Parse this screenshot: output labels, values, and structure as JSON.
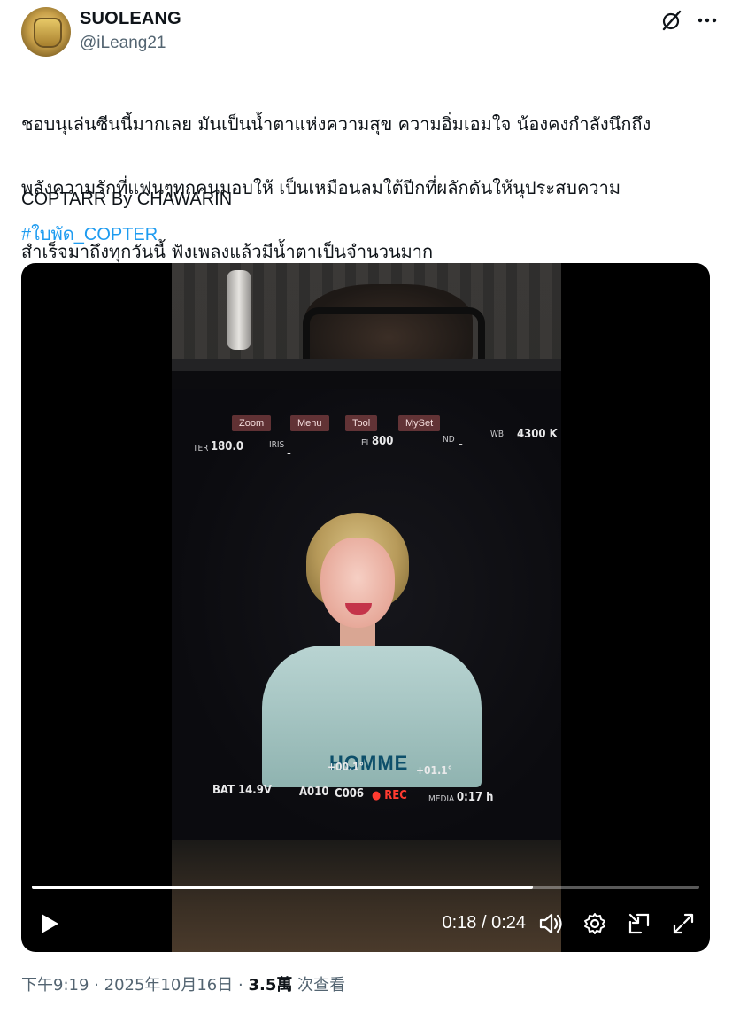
{
  "user": {
    "display_name": "SUOLEANG",
    "handle": "@iLeang21"
  },
  "tweet": {
    "text_line1": "ชอบนุเล่นซีนนี้มากเลย มันเป็นน้ำตาแห่งความสุข ความอิ่มเอมใจ น้องคงกำลังนึกถึง",
    "text_line2": "พลังความรักที่แฟนๆทุกคนมอบให้ เป็นเหมือนลมใต้ปีกที่ผลักดันให้นุประสบความ",
    "text_line3": "สำเร็จมาถึงทุกวันนี้ ฟังเพลงแล้วมีน้ำตาเป็นจำนวนมาก",
    "emojis": [
      "face-holding-back-tears-icon",
      "face-holding-back-tears-icon",
      "face-holding-back-tears-icon"
    ],
    "credit": "COPTARR By CHAWARIN",
    "hashtag": "#ใบพัด_COPTER"
  },
  "video": {
    "hud": {
      "menu_items": [
        "Zoom",
        "Menu",
        "Tool",
        "MySet"
      ],
      "shutter_label": "TER",
      "shutter_value": "180.0",
      "iris_label": "IRIS",
      "iris_value": "-",
      "ei_label": "EI",
      "ei_value": "800",
      "nd_label": "ND",
      "nd_value": "-",
      "wb_label": "WB",
      "wb_value": "4300 K",
      "battery": "BAT 14.9V",
      "clip_a": "A010",
      "clip_c": "C006",
      "rec_label": "REC",
      "media_label": "MEDIA",
      "media_value": "0:17 h",
      "tilt_left": "+00.1°",
      "tilt_right": "+01.1°",
      "shirt_text": "HOMME"
    },
    "current_time": "0:18",
    "duration": "0:24",
    "time_display": "0:18 / 0:24",
    "progress_fraction": 0.75
  },
  "meta": {
    "time": "下午9:19",
    "date": "2025年10月16日",
    "views_count": "3.5萬",
    "views_label": "次查看",
    "separator": "·"
  },
  "icons": {
    "grok": "grok-icon",
    "more": "more-icon",
    "play": "play-icon",
    "volume": "volume-icon",
    "settings": "settings-icon",
    "pip": "picture-in-picture-icon",
    "fullscreen": "fullscreen-icon"
  }
}
